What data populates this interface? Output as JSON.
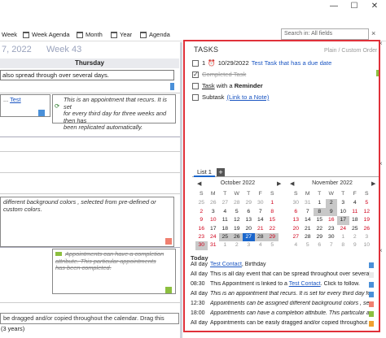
{
  "window": {
    "minimize": "—",
    "maximize": "☐",
    "close": "✕"
  },
  "toolbar": {
    "week_label": "Week",
    "week_agenda_label": "Week Agenda",
    "month_label": "Month",
    "year_label": "Year",
    "agenda_label": "Agenda",
    "search_placeholder": "Search in: All fields"
  },
  "calendar": {
    "date_heading": "7, 2022",
    "week_heading": "Week 43",
    "day_name": "Thursday",
    "events": [
      {
        "text": "also spread through over several days."
      }
    ],
    "recur_event": {
      "prefix": "... ",
      "link": "Test",
      "lines": [
        "This is an appointment that recurs. It is set",
        "for every third day for three weeks and then has",
        "been replicated automatically."
      ]
    },
    "bg_event": {
      "lines": [
        "different background colors , selected from pre-defined or",
        "custom colors."
      ]
    },
    "done_event": {
      "lines": [
        "Appointments can have a completion",
        "attribute. This particular appointments",
        "has been completed."
      ]
    },
    "drag_event": {
      "line1": "be dragged and/or copied throughout the calendar. Drag this",
      "line2": "(3 years)"
    }
  },
  "tasks": {
    "title": "TASKS",
    "order": "Plain / Custom Order",
    "items": [
      {
        "date": "10/29/2022",
        "title": "Test Task that has a due date",
        "checked": false,
        "priority": "1"
      },
      {
        "title": "Completed Task",
        "checked": true
      },
      {
        "title": "Task",
        "suffix": " with a ",
        "bold": "Reminder",
        "checked": false
      },
      {
        "title": "Subtask",
        "link": "(Link to a Note)",
        "checked": false
      }
    ],
    "list_tab": "List 1",
    "add_tab": "+"
  },
  "mini_calendars": [
    {
      "title": "October 2022",
      "day_headers": [
        "S",
        "M",
        "T",
        "W",
        "T",
        "F",
        "S"
      ],
      "weeks": [
        [
          "25",
          "26",
          "27",
          "28",
          "29",
          "30",
          "1"
        ],
        [
          "2",
          "3",
          "4",
          "5",
          "6",
          "7",
          "8"
        ],
        [
          "9",
          "10",
          "11",
          "12",
          "13",
          "14",
          "15"
        ],
        [
          "16",
          "17",
          "18",
          "19",
          "20",
          "21",
          "22"
        ],
        [
          "23",
          "24",
          "25",
          "26",
          "27",
          "28",
          "29"
        ],
        [
          "30",
          "31",
          "1",
          "2",
          "3",
          "4",
          "5"
        ]
      ]
    },
    {
      "title": "November 2022",
      "day_headers": [
        "S",
        "M",
        "T",
        "W",
        "T",
        "F",
        "S"
      ],
      "weeks": [
        [
          "30",
          "31",
          "1",
          "2",
          "3",
          "4",
          "5"
        ],
        [
          "6",
          "7",
          "8",
          "9",
          "10",
          "11",
          "12"
        ],
        [
          "13",
          "14",
          "15",
          "16",
          "17",
          "18",
          "19"
        ],
        [
          "20",
          "21",
          "22",
          "23",
          "24",
          "25",
          "26"
        ],
        [
          "27",
          "28",
          "29",
          "30",
          "1",
          "2",
          "3"
        ],
        [
          "4",
          "5",
          "6",
          "7",
          "8",
          "9",
          "10"
        ]
      ]
    }
  ],
  "agenda": {
    "heading": "Today",
    "rows": [
      {
        "time": "All day",
        "link": "Test Contact",
        "text": ", Birthday",
        "color": "#4a90d9"
      },
      {
        "time": "All day",
        "text": "This is all day event that can be spread throughout over several days",
        "color": "#e9e9e9"
      },
      {
        "time": "08:30",
        "text": "This Appointment is linked to a ",
        "link": "Test Contact",
        "text2": ". Click to follow.",
        "color": "#4a90d9"
      },
      {
        "time": "All day",
        "text": "This is an appointment that recurs. It is set for every third day for thr",
        "color": "#4a90d9"
      },
      {
        "time": "12:30",
        "text": "Appointments can be assigned different background colors , selected fro",
        "color": "#f08070"
      },
      {
        "time": "18:00",
        "text": "Appointments can have a completion attribute. This particular appo",
        "color": "#8cbf3f"
      },
      {
        "time": "All day",
        "text": "Appointments can be easily dragged and/or copied throughout",
        "color": "#f0a030"
      }
    ]
  }
}
